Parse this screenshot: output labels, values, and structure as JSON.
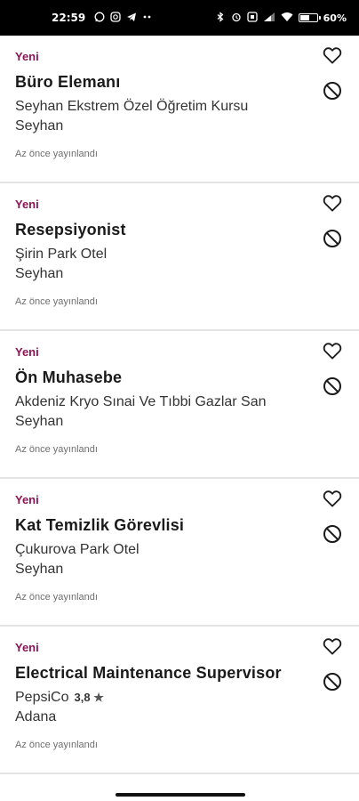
{
  "status_bar": {
    "time": "22:59",
    "left_icons": [
      "whatsapp-icon",
      "instagram-icon",
      "telegram-icon",
      "more-dots-icon"
    ],
    "right_icons": [
      "bluetooth-icon",
      "alarm-icon",
      "nfc-icon",
      "signal-icon",
      "wifi-icon",
      "battery-icon"
    ],
    "battery_percent": "60",
    "battery_level": 0.6
  },
  "jobs": [
    {
      "badge": "Yeni",
      "title": "Büro Elemanı",
      "company": "Seyhan Ekstrem Özel Öğretim Kursu",
      "location": "Seyhan",
      "posted": "Az önce yayınlandı"
    },
    {
      "badge": "Yeni",
      "title": "Resepsiyonist",
      "company": "Şirin Park Otel",
      "location": "Seyhan",
      "posted": "Az önce yayınlandı"
    },
    {
      "badge": "Yeni",
      "title": "Ön Muhasebe",
      "company": "Akdeniz Kryo Sınai Ve Tıbbi Gazlar San",
      "location": "Seyhan",
      "posted": "Az önce yayınlandı"
    },
    {
      "badge": "Yeni",
      "title": "Kat Temizlik Görevlisi",
      "company": "Çukurova Park Otel",
      "location": "Seyhan",
      "posted": "Az önce yayınlandı"
    },
    {
      "badge": "Yeni",
      "title": "Electrical Maintenance Supervisor",
      "company": "PepsiCo",
      "rating": "3,8",
      "location": "Adana",
      "posted": "Az önce yayınlandı"
    }
  ],
  "colors": {
    "badge": "#8b1554",
    "text": "#1a1a1a",
    "divider": "#e3e3e3"
  }
}
